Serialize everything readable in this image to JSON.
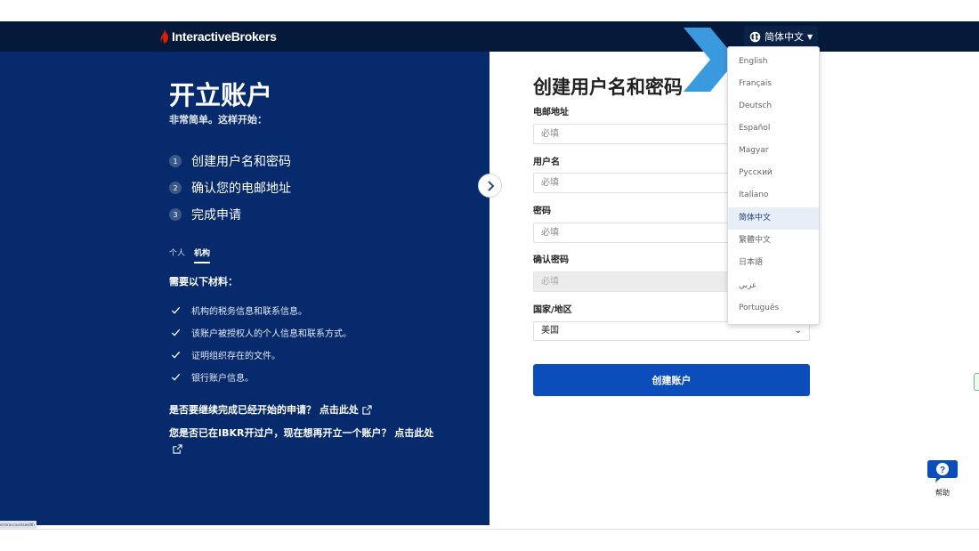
{
  "header": {
    "brand": "InteractiveBrokers",
    "language_button": "简体中文",
    "colors": {
      "nav_bg": "#051a3b",
      "brand_mark": "#d81e05"
    }
  },
  "left_panel": {
    "title": "开立账户",
    "subtitle": "非常简单。这样开始：",
    "steps": [
      {
        "number": "1",
        "label": "创建用户名和密码"
      },
      {
        "number": "2",
        "label": "确认您的电邮地址"
      },
      {
        "number": "3",
        "label": "完成申请"
      }
    ],
    "tabs": [
      {
        "label": "个人",
        "active": false
      },
      {
        "label": "机构",
        "active": true
      }
    ],
    "materials_title": "需要以下材料：",
    "materials": [
      "机构的税务信息和联系信息。",
      "该账户被授权人的个人信息和联系方式。",
      "证明组织存在的文件。",
      "银行账户信息。"
    ],
    "continue_link": "是否要继续完成已经开始的申请？ 点击此处",
    "existing_link": "您是否已在IBKR开过户，现在想再开立一个账户？ 点击此处",
    "bottom_tag": "erroraccountswidth",
    "colors": {
      "panel_bg": "#062a6b"
    }
  },
  "form": {
    "title": "创建用户名和密码",
    "fields": [
      {
        "label": "电邮地址",
        "placeholder": "必填"
      },
      {
        "label": "用户名",
        "placeholder": "必填"
      },
      {
        "label": "密码",
        "placeholder": "必填"
      },
      {
        "label": "确认密码",
        "placeholder": "必填"
      }
    ],
    "country_label": "国家/地区",
    "country_value": "美国",
    "submit_label": "创建账户",
    "colors": {
      "submit_bg": "#0b4dbb"
    }
  },
  "language_dropdown": {
    "options": [
      "English",
      "Français",
      "Deutsch",
      "Español",
      "Magyar",
      "Русский",
      "Italiano",
      "简体中文",
      "繁體中文",
      "日本語",
      "عربي",
      "Português"
    ],
    "selected": "简体中文"
  },
  "help": {
    "label": "帮助"
  },
  "annotation": {
    "arrow_color": "#3a9ae0"
  }
}
